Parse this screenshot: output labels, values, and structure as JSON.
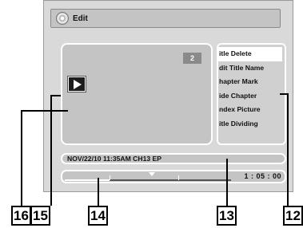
{
  "window": {
    "title": "Edit",
    "icon": "disc-icon"
  },
  "preview": {
    "title_number": "2",
    "play_icon": "play-icon"
  },
  "menu": {
    "items": [
      {
        "label": "itle Delete"
      },
      {
        "label": "dit Title Name"
      },
      {
        "label": "hapter Mark"
      },
      {
        "label": "ide Chapter"
      },
      {
        "label": "ndex Picture"
      },
      {
        "label": "itle Dividing"
      }
    ],
    "selected_index": 0
  },
  "info": {
    "text": "NOV/22/10 11:35AM CH13 EP"
  },
  "progress": {
    "time": "1 : 05 : 00",
    "fraction": 0.27
  },
  "callouts": {
    "c16": "16",
    "c15": "15",
    "c14": "14",
    "c13": "13",
    "c12": "12"
  }
}
